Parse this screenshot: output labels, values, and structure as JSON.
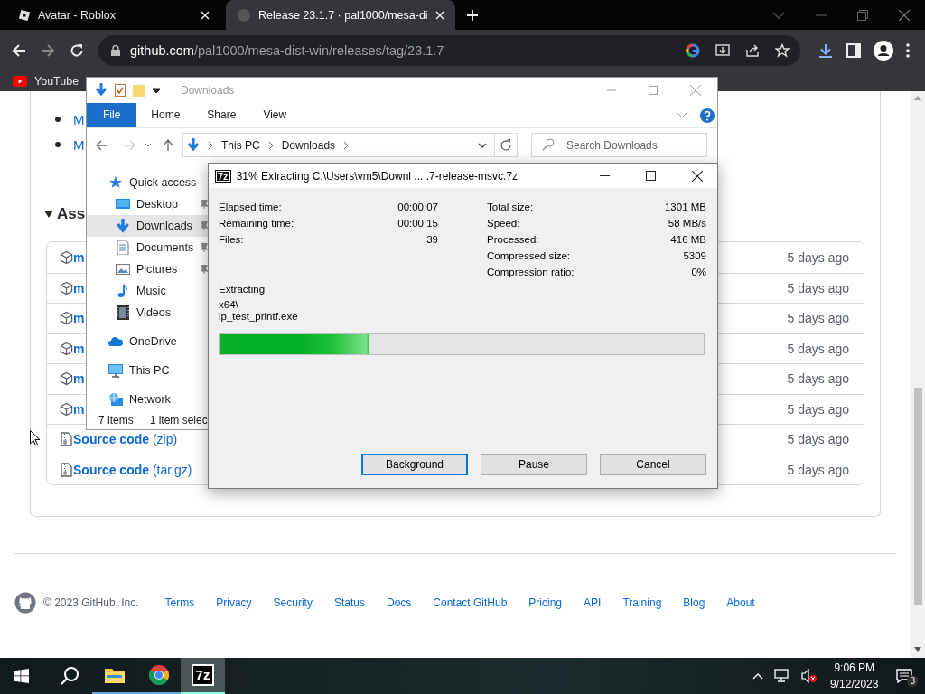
{
  "browser": {
    "tabs": [
      {
        "title": "Avatar - Roblox",
        "selected": false
      },
      {
        "title": "Release 23.1.7 · pal1000/mesa-di",
        "selected": true
      }
    ],
    "address": {
      "host": "github.com",
      "path": "/pal1000/mesa-dist-win/releases/tag/23.1.7"
    },
    "bookmarks": [
      "YouTube"
    ]
  },
  "page": {
    "list_items": [
      "M",
      "M"
    ],
    "assets_heading": "Ass",
    "assets": [
      {
        "kind": "package",
        "name": "m",
        "age": "5 days ago"
      },
      {
        "kind": "package",
        "name": "m",
        "age": "5 days ago"
      },
      {
        "kind": "package",
        "name": "m",
        "age": "5 days ago"
      },
      {
        "kind": "package",
        "name": "m",
        "age": "5 days ago"
      },
      {
        "kind": "package",
        "name": "m",
        "age": "5 days ago"
      },
      {
        "kind": "package",
        "name": "m",
        "age": "5 days ago"
      },
      {
        "kind": "source",
        "name": "**Source code** (zip)",
        "age": "5 days ago"
      },
      {
        "kind": "source",
        "name": "**Source code** (tar.gz)",
        "age": "5 days ago"
      }
    ],
    "footer": {
      "copyright": "© 2023 GitHub, Inc.",
      "links": [
        "Terms",
        "Privacy",
        "Security",
        "Status",
        "Docs",
        "Contact GitHub",
        "Pricing",
        "API",
        "Training",
        "Blog",
        "About"
      ]
    }
  },
  "explorer": {
    "title": "Downloads",
    "ribbon_tabs": [
      {
        "label": "File",
        "selected": true
      },
      {
        "label": "Home",
        "selected": false
      },
      {
        "label": "Share",
        "selected": false
      },
      {
        "label": "View",
        "selected": false
      }
    ],
    "breadcrumb": [
      "This PC",
      "Downloads"
    ],
    "search": {
      "placeholder": "Search Downloads"
    },
    "nav": [
      {
        "label": "Quick access",
        "kind": "star",
        "selected": false,
        "children": [
          {
            "label": "Desktop",
            "kind": "desktop",
            "selected": false,
            "pinned": true
          },
          {
            "label": "Downloads",
            "kind": "download",
            "selected": true,
            "pinned": true
          },
          {
            "label": "Documents",
            "kind": "document",
            "selected": false,
            "pinned": true
          },
          {
            "label": "Pictures",
            "kind": "pictures",
            "selected": false,
            "pinned": true
          },
          {
            "label": "Music",
            "kind": "music",
            "selected": false,
            "pinned": false
          },
          {
            "label": "Videos",
            "kind": "video",
            "selected": false,
            "pinned": false
          }
        ]
      },
      {
        "label": "OneDrive",
        "kind": "cloud",
        "selected": false
      },
      {
        "label": "This PC",
        "kind": "pc",
        "selected": false
      },
      {
        "label": "Network",
        "kind": "network",
        "selected": false
      }
    ],
    "status": [
      "7 items",
      "1 item selec"
    ]
  },
  "dialog": {
    "app_badge": "7z",
    "title": "31% Extracting C:\\Users\\vm5\\Downl ... .7-release-msvc.7z",
    "left_stats": [
      {
        "label": "Elapsed time:",
        "value": "00:00:07"
      },
      {
        "label": "Remaining time:",
        "value": "00:00:15"
      },
      {
        "label": "Files:",
        "value": "39"
      }
    ],
    "right_stats": [
      {
        "label": "Total size:",
        "value": "1301 MB"
      },
      {
        "label": "Speed:",
        "value": "58 MB/s"
      },
      {
        "label": "Processed:",
        "value": "416 MB"
      },
      {
        "label": "Compressed size:",
        "value": "5309"
      },
      {
        "label": "Compression ratio:",
        "value": "0%"
      }
    ],
    "status_label": "Extracting",
    "current_path": [
      "x64\\",
      "lp_test_printf.exe"
    ],
    "progress": {
      "level": 0.31
    },
    "buttons": [
      {
        "label": "Background",
        "selected": true
      },
      {
        "label": "Pause",
        "selected": false
      },
      {
        "label": "Cancel",
        "selected": false
      }
    ]
  },
  "taskbar": {
    "apps": [
      {
        "kind": "explorer",
        "active": false
      },
      {
        "kind": "chrome",
        "active": false
      },
      {
        "kind": "archiver",
        "active": true,
        "badge": "7z"
      }
    ],
    "time": "9:06 PM",
    "date": "9/12/2023",
    "notifications": "3"
  }
}
